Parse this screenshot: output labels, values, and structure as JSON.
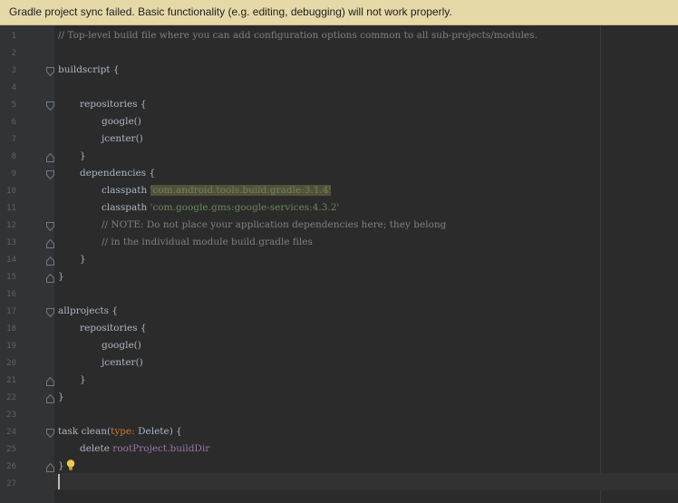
{
  "banner": {
    "message": "Gradle project sync failed. Basic functionality (e.g. editing, debugging) will not work properly."
  },
  "editor": {
    "line_numbers": [
      "1",
      "2",
      "3",
      "4",
      "5",
      "6",
      "7",
      "8",
      "9",
      "10",
      "11",
      "12",
      "13",
      "14",
      "15",
      "16",
      "17",
      "18",
      "19",
      "20",
      "21",
      "22",
      "23",
      "24",
      "25",
      "26",
      "27"
    ],
    "current_line": 27,
    "lines": {
      "l1": "// Top-level build file where you can add configuration options common to all sub-projects/modules.",
      "l3": "buildscript {",
      "l5": "repositories {",
      "l6": "google()",
      "l7": "jcenter()",
      "l8": "}",
      "l9": "dependencies {",
      "l10_kw": "classpath",
      "l10_str": "'com.android.tools.build:gradle:3.1.4'",
      "l11_kw": "classpath",
      "l11_str": "'com.google.gms:google-services:4.3.2'",
      "l12": "// NOTE: Do not place your application dependencies here; they belong",
      "l13": "// in the individual module build.gradle files",
      "l14": "}",
      "l15": "}",
      "l17": "allprojects {",
      "l18": "repositories {",
      "l19": "google()",
      "l20": "jcenter()",
      "l21": "}",
      "l22": "}",
      "l24_a": "task clean(",
      "l24_param": "type:",
      "l24_b": " Delete) {",
      "l25_kw": "delete",
      "l25_prop": "rootProject.buildDir",
      "l26": "}"
    }
  },
  "colors": {
    "banner_bg": "#e6d9a8",
    "editor_bg": "#2b2b2b",
    "gutter_bg": "#313335",
    "comment": "#808080",
    "string": "#6a8759",
    "keyword": "#cc7832",
    "property": "#9876aa",
    "default_text": "#a9b7c6"
  },
  "icons": {
    "fold_marker": "fold-marker-icon",
    "intention_bulb": "lightbulb-icon"
  }
}
